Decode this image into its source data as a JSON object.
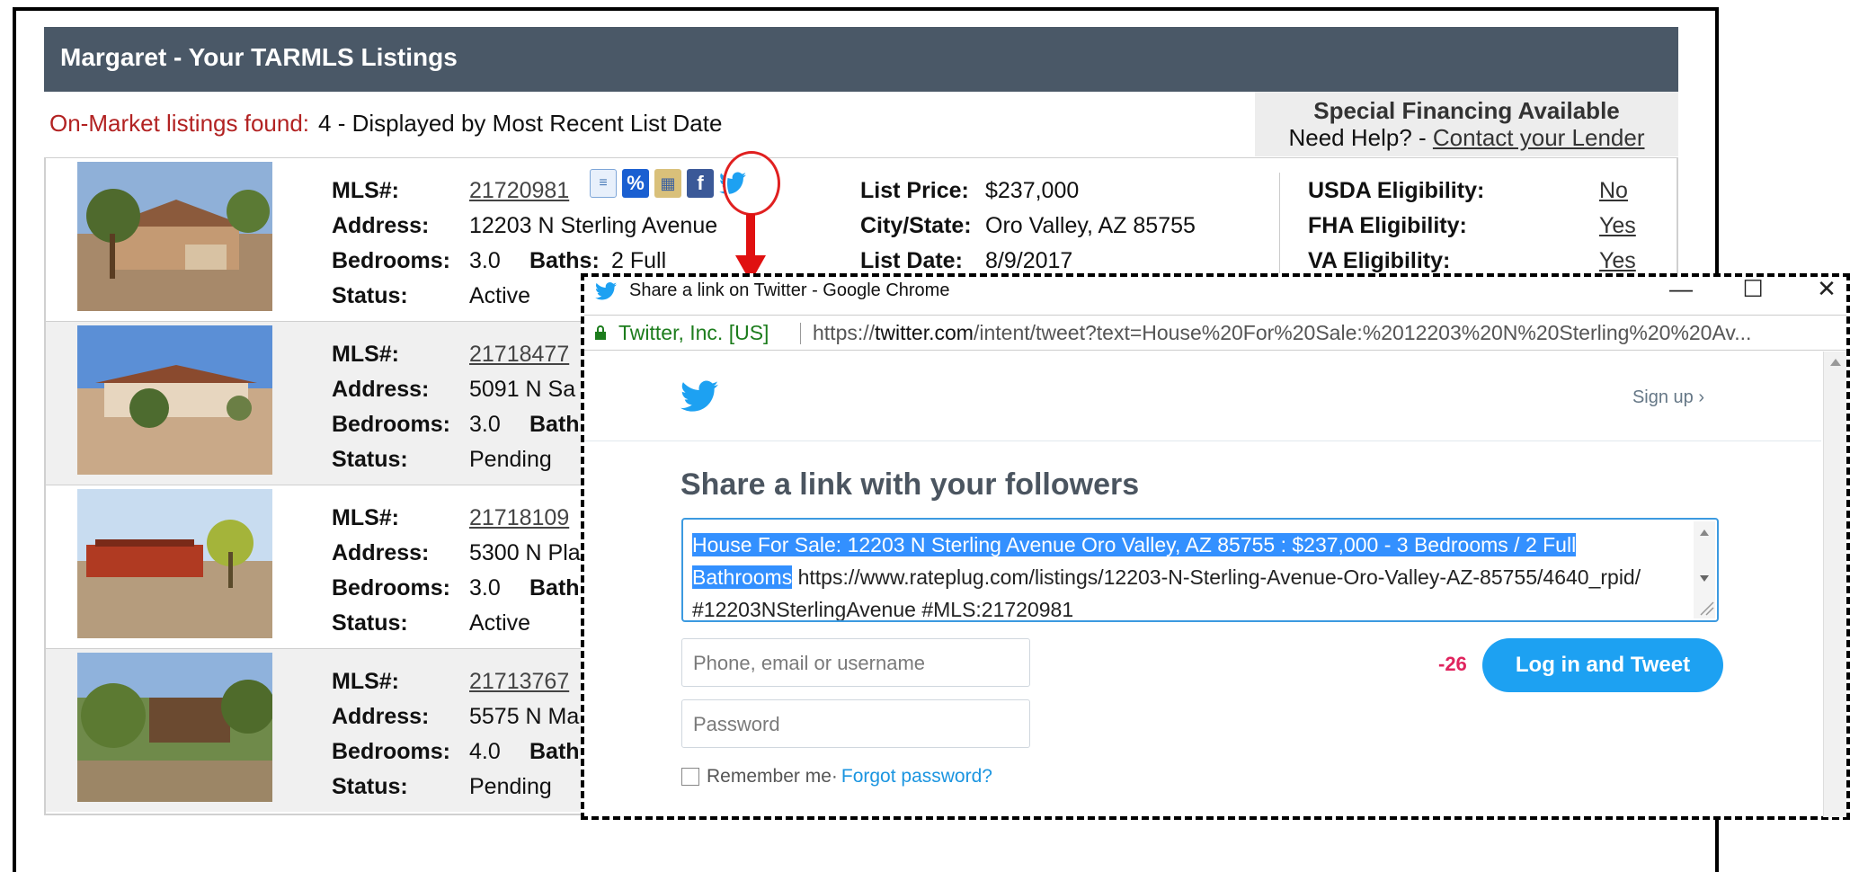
{
  "header": {
    "title": "Margaret -  Your TARMLS Listings"
  },
  "summary": {
    "found_label": "On-Market listings found:",
    "found_text": "4 - Displayed by Most Recent List Date"
  },
  "financing": {
    "title": "Special Financing Available",
    "help_text": "Need Help? - ",
    "link": "Contact your Lender"
  },
  "labels": {
    "mls": "MLS#:",
    "address": "Address:",
    "bedrooms": "Bedrooms:",
    "baths": "Baths:",
    "status": "Status:",
    "list_price": "List Price:",
    "city_state": "City/State:",
    "list_date": "List Date:",
    "usda": "USDA Eligibility:",
    "fha": "FHA Eligibility:",
    "va": "VA Eligibility:"
  },
  "listings": [
    {
      "mls": "21720981",
      "address": "12203 N Sterling Avenue",
      "bedrooms": "3.0",
      "baths": "2 Full",
      "status": "Active",
      "list_price": "$237,000",
      "city_state": "Oro Valley, AZ 85755",
      "list_date": "8/9/2017",
      "usda": "No",
      "fha": "Yes",
      "va": "Yes"
    },
    {
      "mls": "21718477",
      "address": "5091 N Sa",
      "bedrooms": "3.0",
      "baths_partial": "Bath",
      "status": "Pending"
    },
    {
      "mls": "21718109",
      "address": "5300 N Pla",
      "bedrooms": "3.0",
      "baths_partial": "Bath",
      "status": "Active"
    },
    {
      "mls": "21713767",
      "address": "5575 N Ma",
      "bedrooms": "4.0",
      "baths_partial": "Bath",
      "status": "Pending"
    }
  ],
  "share_icons": [
    "document-icon",
    "percent-icon",
    "calculator-icon",
    "facebook-icon",
    "twitter-icon"
  ],
  "popup": {
    "window_title": "Share a link on Twitter - Google Chrome",
    "minimize": "—",
    "maximize": "☐",
    "close": "✕",
    "secure_label": "Twitter, Inc. [US]",
    "url_scheme": "https://",
    "url_host": "twitter.com",
    "url_rest": "/intent/tweet?text=House%20For%20Sale:%2012203%20N%20Sterling%20%20Av...",
    "signup": "Sign up ›",
    "share_title": "Share a link with your followers",
    "tweet_selected": "House For Sale: 12203 N Sterling  Avenue  Oro Valley, AZ 85755 : $237,000  - 3 Bedrooms / 2 Full Bathrooms",
    "tweet_rest": " https://www.rateplug.com/listings/12203-N-Sterling-Avenue-Oro-Valley-AZ-85755/4640_rpid/ #12203NSterlingAvenue #MLS:21720981",
    "username_placeholder": "Phone, email or username",
    "password_placeholder": "Password",
    "counter": "-26",
    "tweet_button": "Log in and Tweet",
    "remember": "Remember me",
    "separator": " · ",
    "forgot": "Forgot password?"
  },
  "colors": {
    "header_bg": "#4a5867",
    "found_label": "#b22222",
    "twitter_blue": "#1da1f2",
    "counter_red": "#e0245e",
    "highlight_red": "#e02020"
  }
}
